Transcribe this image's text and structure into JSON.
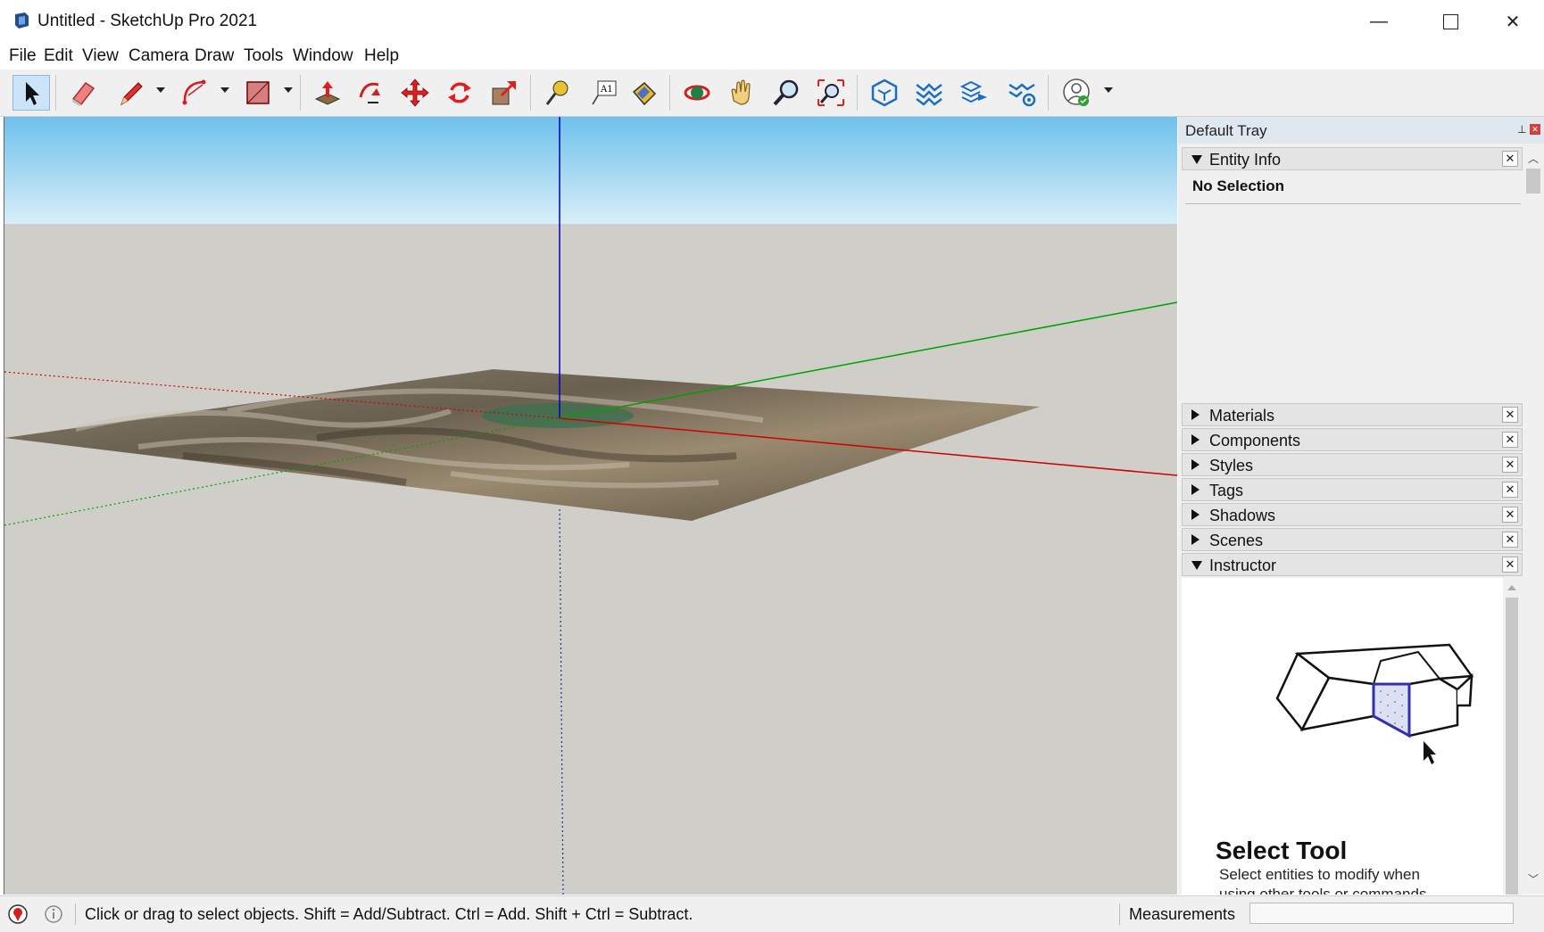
{
  "window": {
    "title": "Untitled - SketchUp Pro 2021"
  },
  "menu": [
    "File",
    "Edit",
    "View",
    "Camera",
    "Draw",
    "Tools",
    "Window",
    "Help"
  ],
  "toolbar": {
    "tools": [
      "select",
      "eraser",
      "line",
      "arc",
      "shape",
      "push-pull",
      "follow-me",
      "move",
      "rotate",
      "scale",
      "tape-measure",
      "text",
      "paint-bucket",
      "orbit",
      "pan",
      "zoom",
      "zoom-extents",
      "geo-location",
      "terrain",
      "add-location",
      "location-settings",
      "account"
    ]
  },
  "tray": {
    "title": "Default Tray",
    "entity_info": {
      "label": "Entity Info",
      "status": "No Selection"
    },
    "panels": [
      "Materials",
      "Components",
      "Styles",
      "Tags",
      "Shadows",
      "Scenes"
    ],
    "instructor": {
      "label": "Instructor",
      "tool_title": "Select Tool",
      "desc_line1": "Select entities to modify when",
      "desc_line2": "using other tools or commands."
    }
  },
  "status": {
    "message": "Click or drag to select objects. Shift = Add/Subtract. Ctrl = Add. Shift + Ctrl = Subtract.",
    "measurements_label": "Measurements"
  },
  "colors": {
    "sky": "#a8d8f0",
    "ground": "#cfcec8",
    "axis_red": "#d00000",
    "axis_green": "#00a000",
    "axis_blue": "#0000c0",
    "selection_blue": "#3030b0"
  }
}
